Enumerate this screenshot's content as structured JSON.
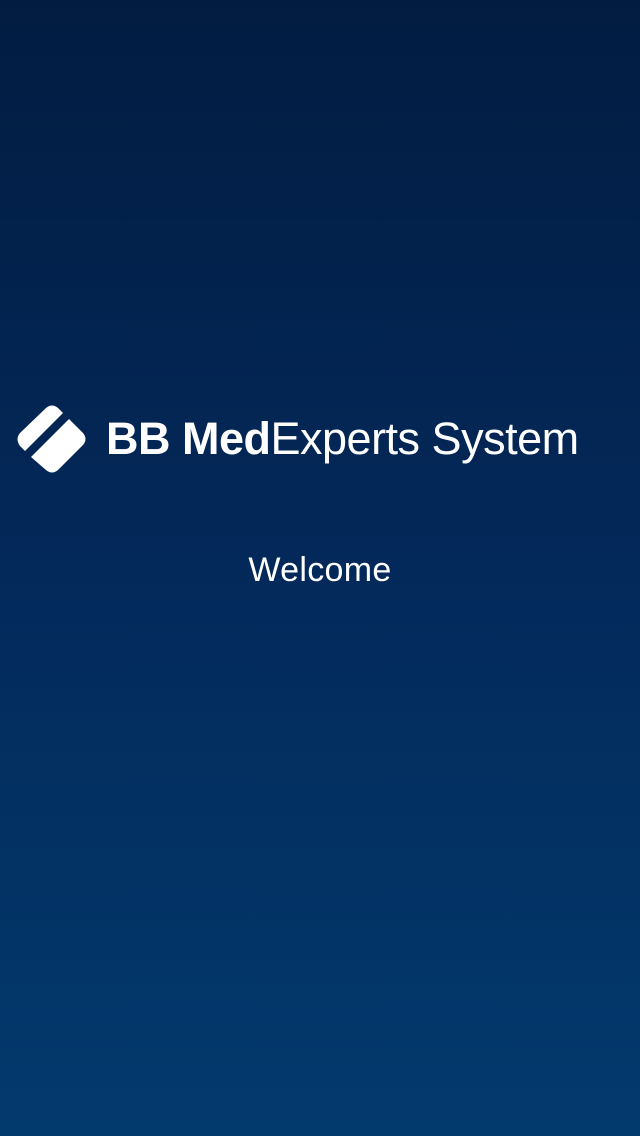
{
  "brand": {
    "name_bold": "BB Med",
    "name_regular": "Experts System",
    "logo_icon": "bb-diamond-logo-icon"
  },
  "welcome": {
    "text": "Welcome"
  },
  "colors": {
    "background_top": "#021c41",
    "background_bottom": "#033a6e",
    "text": "#ffffff"
  }
}
